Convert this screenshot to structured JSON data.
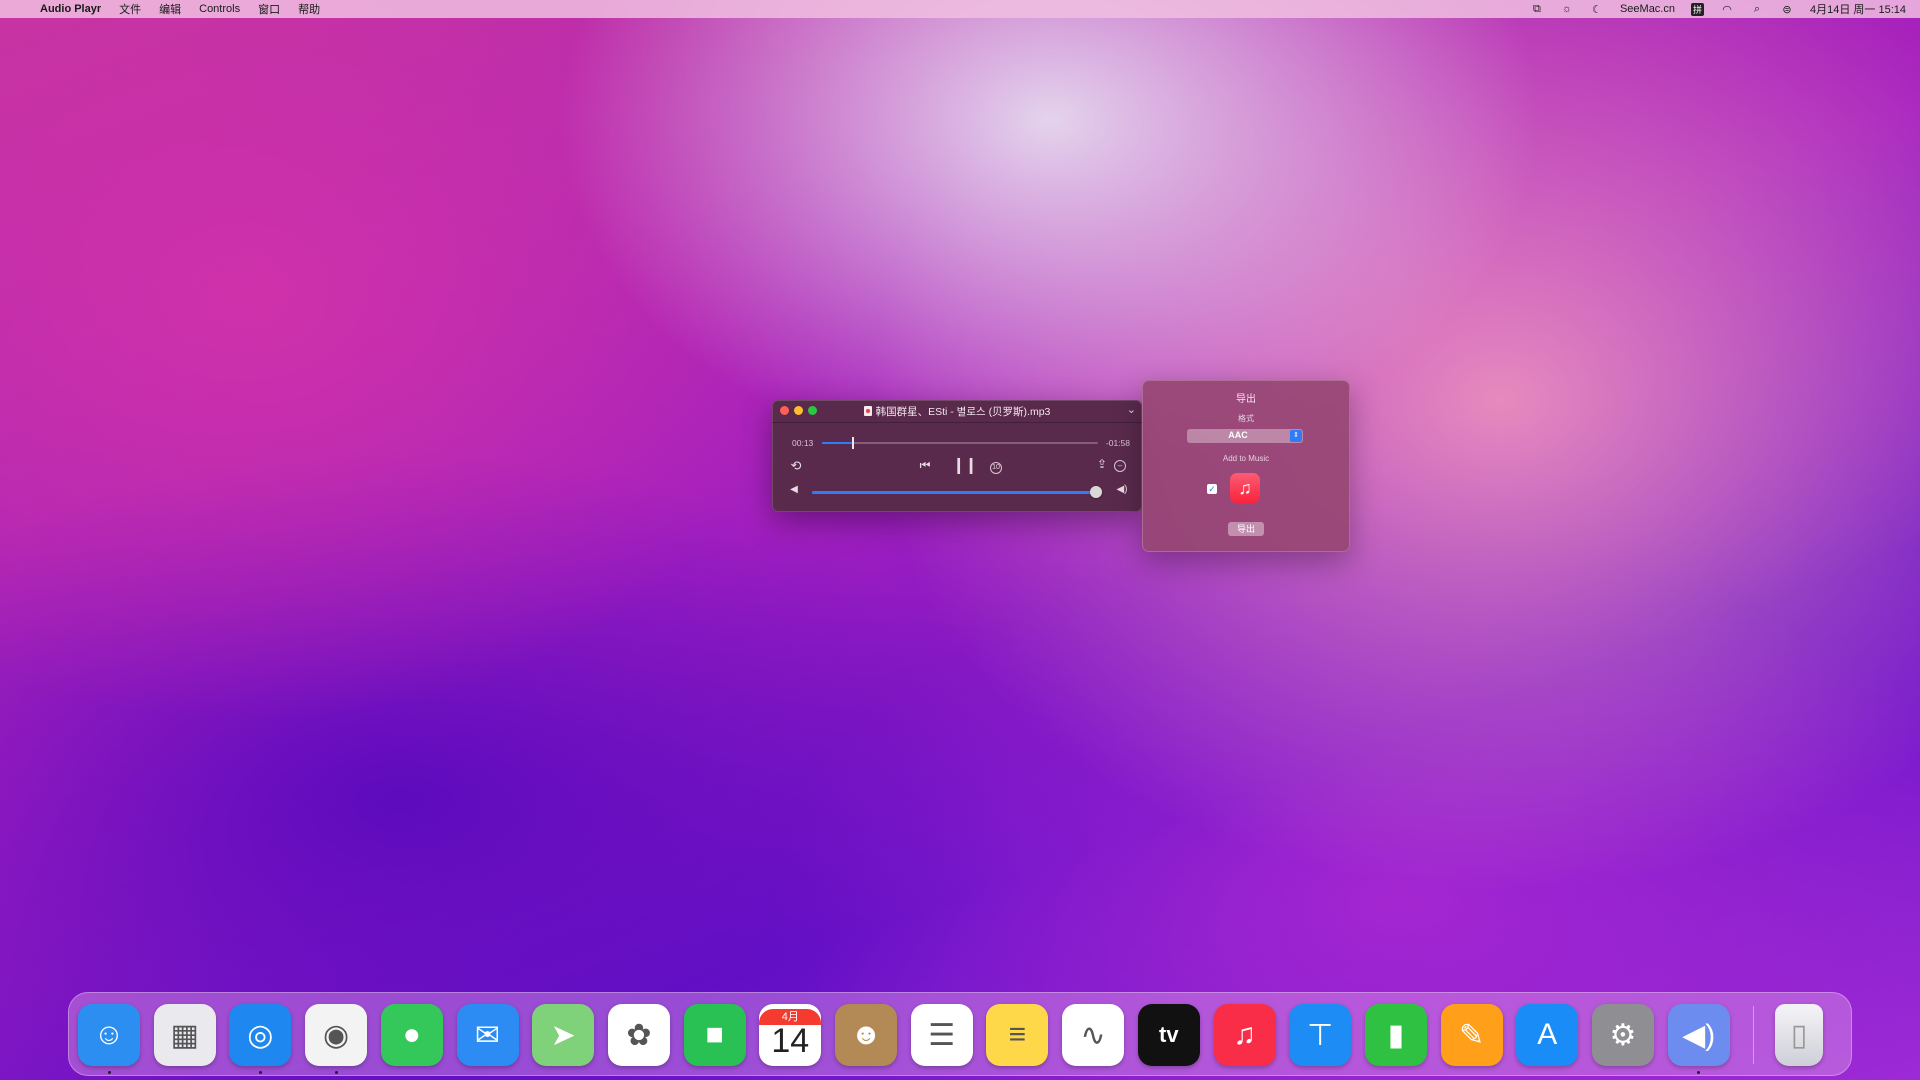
{
  "menubar": {
    "apple": "",
    "app_name": "Audio Playr",
    "menus": [
      "文件",
      "编辑",
      "Controls",
      "窗口",
      "帮助"
    ],
    "status": {
      "seemac": "SeeMac.cn",
      "input_method": "拼",
      "datetime": "4月14日 周一  15:14"
    }
  },
  "player": {
    "title": "韩国群星、ESti - 별로스 (贝罗斯).mp3",
    "elapsed": "00:13",
    "remaining": "-01:58",
    "progress_fraction": 0.11,
    "volume_fraction": 1.0,
    "skip_label": "10"
  },
  "export_popover": {
    "title": "导出",
    "format_label": "格式",
    "format_value": "AAC",
    "add_to_music_label": "Add to Music",
    "add_to_music_checked": true,
    "checkmark": "✓",
    "export_button": "导出"
  },
  "dock": {
    "calendar_month": "4月",
    "calendar_day": "14",
    "apps": [
      {
        "name": "finder",
        "icon": "finder-icon",
        "glyph": "☺",
        "color": "#2b8ef0",
        "running": true
      },
      {
        "name": "launchpad",
        "icon": "launchpad-icon",
        "glyph": "▦",
        "color": "#e9e9ee",
        "running": false
      },
      {
        "name": "safari",
        "icon": "safari-icon",
        "glyph": "◎",
        "color": "#1e88f0",
        "running": true
      },
      {
        "name": "chrome",
        "icon": "chrome-icon",
        "glyph": "◉",
        "color": "#f3f3f3",
        "running": true
      },
      {
        "name": "messages",
        "icon": "messages-icon",
        "glyph": "●",
        "color": "#34c759",
        "running": false
      },
      {
        "name": "mail",
        "icon": "mail-icon",
        "glyph": "✉",
        "color": "#2c8cf4",
        "running": false
      },
      {
        "name": "maps",
        "icon": "maps-icon",
        "glyph": "➤",
        "color": "#7fd17a",
        "running": false
      },
      {
        "name": "photos",
        "icon": "photos-icon",
        "glyph": "✿",
        "color": "#ffffff",
        "running": false
      },
      {
        "name": "facetime",
        "icon": "facetime-icon",
        "glyph": "■",
        "color": "#2ac154",
        "running": false
      },
      {
        "name": "calendar",
        "icon": "calendar-icon",
        "glyph": "",
        "color": "#ffffff",
        "running": false
      },
      {
        "name": "contacts",
        "icon": "contacts-icon",
        "glyph": "☻",
        "color": "#b38a55",
        "running": false
      },
      {
        "name": "reminders",
        "icon": "reminders-icon",
        "glyph": "☰",
        "color": "#ffffff",
        "running": false
      },
      {
        "name": "notes",
        "icon": "notes-icon",
        "glyph": "≡",
        "color": "#ffd84a",
        "running": false
      },
      {
        "name": "freeform",
        "icon": "freeform-icon",
        "glyph": "∿",
        "color": "#ffffff",
        "running": false
      },
      {
        "name": "apple-tv",
        "icon": "tv-icon",
        "glyph": "tv",
        "color": "#111111",
        "running": false
      },
      {
        "name": "music",
        "icon": "music-icon",
        "glyph": "♫",
        "color": "#fa2d48",
        "running": false
      },
      {
        "name": "keynote",
        "icon": "keynote-icon",
        "glyph": "⊤",
        "color": "#1d8df5",
        "running": false
      },
      {
        "name": "numbers",
        "icon": "numbers-icon",
        "glyph": "▮",
        "color": "#2fc142",
        "running": false
      },
      {
        "name": "pages",
        "icon": "pages-icon",
        "glyph": "✎",
        "color": "#ff9f1a",
        "running": false
      },
      {
        "name": "app-store",
        "icon": "app-store-icon",
        "glyph": "A",
        "color": "#1a8cf7",
        "running": false
      },
      {
        "name": "system-settings",
        "icon": "settings-icon",
        "glyph": "⚙",
        "color": "#8e8e93",
        "running": false
      },
      {
        "name": "audio-playr",
        "icon": "speaker-icon",
        "glyph": "◀)",
        "color": "#6d8cf0",
        "running": true
      }
    ],
    "trash": {
      "name": "trash",
      "icon": "trash-icon",
      "glyph": "▯",
      "color": "#e8e8ee"
    }
  }
}
